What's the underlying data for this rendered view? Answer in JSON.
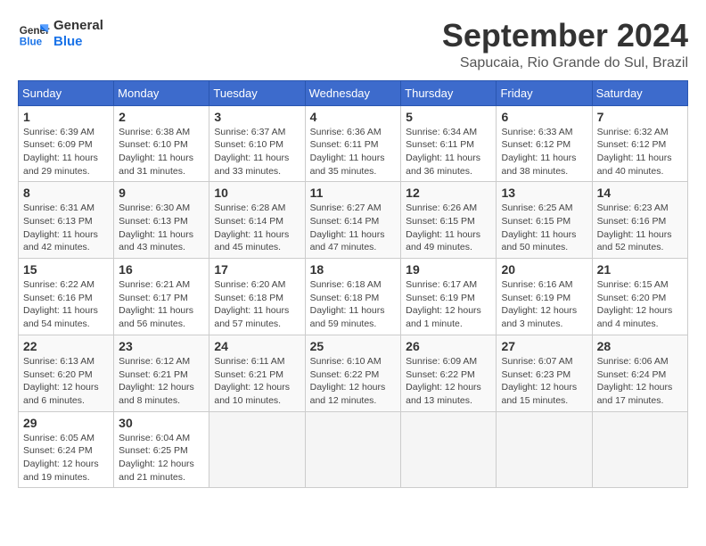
{
  "logo": {
    "line1": "General",
    "line2": "Blue"
  },
  "title": "September 2024",
  "location": "Sapucaia, Rio Grande do Sul, Brazil",
  "weekdays": [
    "Sunday",
    "Monday",
    "Tuesday",
    "Wednesday",
    "Thursday",
    "Friday",
    "Saturday"
  ],
  "weeks": [
    [
      {
        "day": "1",
        "info": "Sunrise: 6:39 AM\nSunset: 6:09 PM\nDaylight: 11 hours\nand 29 minutes."
      },
      {
        "day": "2",
        "info": "Sunrise: 6:38 AM\nSunset: 6:10 PM\nDaylight: 11 hours\nand 31 minutes."
      },
      {
        "day": "3",
        "info": "Sunrise: 6:37 AM\nSunset: 6:10 PM\nDaylight: 11 hours\nand 33 minutes."
      },
      {
        "day": "4",
        "info": "Sunrise: 6:36 AM\nSunset: 6:11 PM\nDaylight: 11 hours\nand 35 minutes."
      },
      {
        "day": "5",
        "info": "Sunrise: 6:34 AM\nSunset: 6:11 PM\nDaylight: 11 hours\nand 36 minutes."
      },
      {
        "day": "6",
        "info": "Sunrise: 6:33 AM\nSunset: 6:12 PM\nDaylight: 11 hours\nand 38 minutes."
      },
      {
        "day": "7",
        "info": "Sunrise: 6:32 AM\nSunset: 6:12 PM\nDaylight: 11 hours\nand 40 minutes."
      }
    ],
    [
      {
        "day": "8",
        "info": "Sunrise: 6:31 AM\nSunset: 6:13 PM\nDaylight: 11 hours\nand 42 minutes."
      },
      {
        "day": "9",
        "info": "Sunrise: 6:30 AM\nSunset: 6:13 PM\nDaylight: 11 hours\nand 43 minutes."
      },
      {
        "day": "10",
        "info": "Sunrise: 6:28 AM\nSunset: 6:14 PM\nDaylight: 11 hours\nand 45 minutes."
      },
      {
        "day": "11",
        "info": "Sunrise: 6:27 AM\nSunset: 6:14 PM\nDaylight: 11 hours\nand 47 minutes."
      },
      {
        "day": "12",
        "info": "Sunrise: 6:26 AM\nSunset: 6:15 PM\nDaylight: 11 hours\nand 49 minutes."
      },
      {
        "day": "13",
        "info": "Sunrise: 6:25 AM\nSunset: 6:15 PM\nDaylight: 11 hours\nand 50 minutes."
      },
      {
        "day": "14",
        "info": "Sunrise: 6:23 AM\nSunset: 6:16 PM\nDaylight: 11 hours\nand 52 minutes."
      }
    ],
    [
      {
        "day": "15",
        "info": "Sunrise: 6:22 AM\nSunset: 6:16 PM\nDaylight: 11 hours\nand 54 minutes."
      },
      {
        "day": "16",
        "info": "Sunrise: 6:21 AM\nSunset: 6:17 PM\nDaylight: 11 hours\nand 56 minutes."
      },
      {
        "day": "17",
        "info": "Sunrise: 6:20 AM\nSunset: 6:18 PM\nDaylight: 11 hours\nand 57 minutes."
      },
      {
        "day": "18",
        "info": "Sunrise: 6:18 AM\nSunset: 6:18 PM\nDaylight: 11 hours\nand 59 minutes."
      },
      {
        "day": "19",
        "info": "Sunrise: 6:17 AM\nSunset: 6:19 PM\nDaylight: 12 hours\nand 1 minute."
      },
      {
        "day": "20",
        "info": "Sunrise: 6:16 AM\nSunset: 6:19 PM\nDaylight: 12 hours\nand 3 minutes."
      },
      {
        "day": "21",
        "info": "Sunrise: 6:15 AM\nSunset: 6:20 PM\nDaylight: 12 hours\nand 4 minutes."
      }
    ],
    [
      {
        "day": "22",
        "info": "Sunrise: 6:13 AM\nSunset: 6:20 PM\nDaylight: 12 hours\nand 6 minutes."
      },
      {
        "day": "23",
        "info": "Sunrise: 6:12 AM\nSunset: 6:21 PM\nDaylight: 12 hours\nand 8 minutes."
      },
      {
        "day": "24",
        "info": "Sunrise: 6:11 AM\nSunset: 6:21 PM\nDaylight: 12 hours\nand 10 minutes."
      },
      {
        "day": "25",
        "info": "Sunrise: 6:10 AM\nSunset: 6:22 PM\nDaylight: 12 hours\nand 12 minutes."
      },
      {
        "day": "26",
        "info": "Sunrise: 6:09 AM\nSunset: 6:22 PM\nDaylight: 12 hours\nand 13 minutes."
      },
      {
        "day": "27",
        "info": "Sunrise: 6:07 AM\nSunset: 6:23 PM\nDaylight: 12 hours\nand 15 minutes."
      },
      {
        "day": "28",
        "info": "Sunrise: 6:06 AM\nSunset: 6:24 PM\nDaylight: 12 hours\nand 17 minutes."
      }
    ],
    [
      {
        "day": "29",
        "info": "Sunrise: 6:05 AM\nSunset: 6:24 PM\nDaylight: 12 hours\nand 19 minutes."
      },
      {
        "day": "30",
        "info": "Sunrise: 6:04 AM\nSunset: 6:25 PM\nDaylight: 12 hours\nand 21 minutes."
      },
      {
        "day": "",
        "info": ""
      },
      {
        "day": "",
        "info": ""
      },
      {
        "day": "",
        "info": ""
      },
      {
        "day": "",
        "info": ""
      },
      {
        "day": "",
        "info": ""
      }
    ]
  ]
}
